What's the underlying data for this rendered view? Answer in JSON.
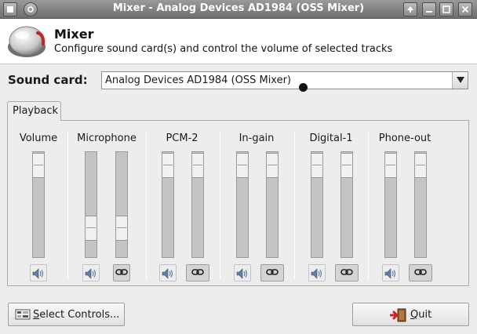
{
  "window": {
    "title": "Mixer - Analog Devices AD1984 (OSS Mixer)"
  },
  "header": {
    "title": "Mixer",
    "subtitle": "Configure sound card(s) and control the volume of selected tracks"
  },
  "soundcard": {
    "label": "Sound card:",
    "selected": "Analog Devices AD1984 (OSS Mixer)"
  },
  "tabs": [
    {
      "label": "Playback",
      "active": true
    }
  ],
  "channels": [
    {
      "name": "Volume",
      "sliders": [
        0.98
      ],
      "mute": true,
      "lock": false
    },
    {
      "name": "Microphone",
      "sliders": [
        0.2,
        0.2
      ],
      "mute": true,
      "lock": true
    },
    {
      "name": "PCM-2",
      "sliders": [
        0.98,
        0.98
      ],
      "mute": true,
      "lock": true
    },
    {
      "name": "In-gain",
      "sliders": [
        0.98,
        0.98
      ],
      "mute": true,
      "lock": true
    },
    {
      "name": "Digital-1",
      "sliders": [
        0.98,
        0.98
      ],
      "mute": true,
      "lock": true
    },
    {
      "name": "Phone-out",
      "sliders": [
        0.98,
        0.98
      ],
      "mute": true,
      "lock": true
    }
  ],
  "buttons": {
    "select_controls": {
      "mnemonic": "S",
      "rest": "elect Controls..."
    },
    "quit": {
      "mnemonic": "Q",
      "rest": "uit"
    }
  }
}
